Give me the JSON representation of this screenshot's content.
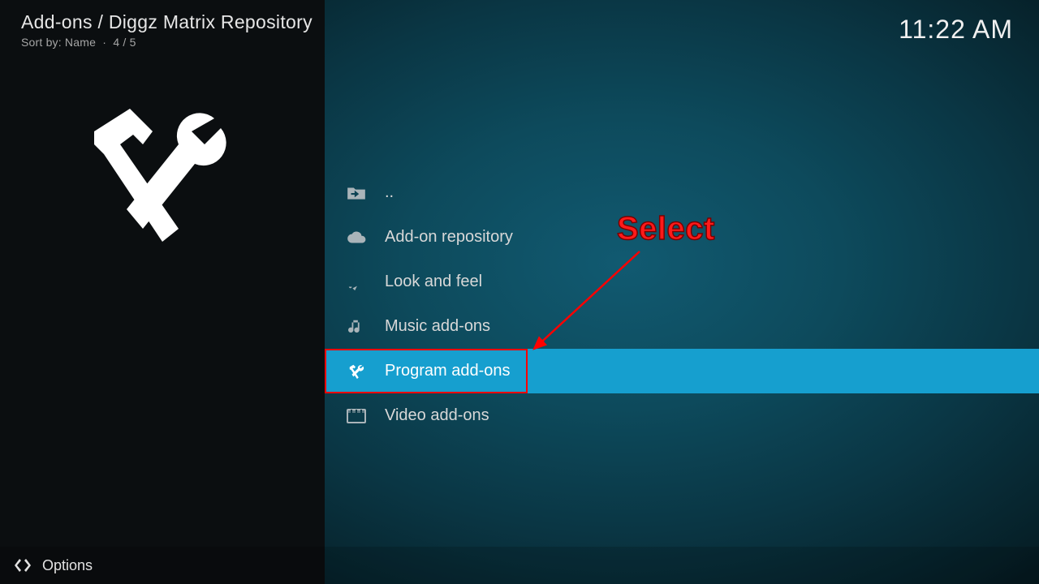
{
  "header": {
    "breadcrumb": "Add-ons / Diggz Matrix Repository",
    "sort_label": "Sort by: Name",
    "counter": "4 / 5",
    "clock": "11:22 AM"
  },
  "list": {
    "parent_label": "..",
    "items": [
      {
        "icon": "cloud-icon",
        "label": "Add-on repository",
        "selected": false
      },
      {
        "icon": "paint-icon",
        "label": "Look and feel",
        "selected": false
      },
      {
        "icon": "music-icon",
        "label": "Music add-ons",
        "selected": false
      },
      {
        "icon": "tools-icon",
        "label": "Program add-ons",
        "selected": true
      },
      {
        "icon": "video-icon",
        "label": "Video add-ons",
        "selected": false
      }
    ]
  },
  "footer": {
    "options_label": "Options"
  },
  "annotation": {
    "label": "Select"
  }
}
